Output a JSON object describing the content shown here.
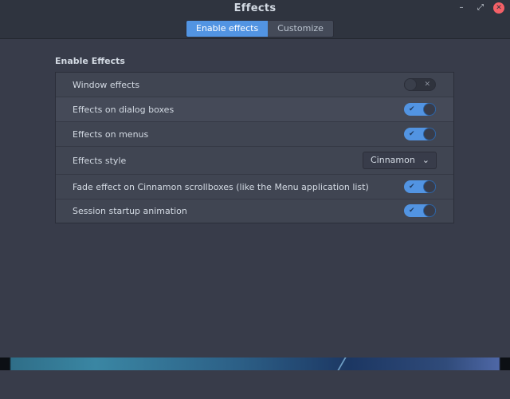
{
  "window": {
    "title": "Effects",
    "minimize_glyph": "–",
    "maximize_glyph": "⤢",
    "close_glyph": "✕"
  },
  "tabs": [
    {
      "label": "Enable effects",
      "active": true
    },
    {
      "label": "Customize",
      "active": false
    }
  ],
  "section": {
    "title": "Enable Effects"
  },
  "settings": [
    {
      "label": "Window effects",
      "control": "switch",
      "state": "off"
    },
    {
      "label": "Effects on dialog boxes",
      "control": "switch",
      "state": "on"
    },
    {
      "label": "Effects on menus",
      "control": "switch",
      "state": "on"
    },
    {
      "label": "Effects style",
      "control": "dropdown",
      "value": "Cinnamon"
    },
    {
      "label": "Fade effect on Cinnamon scrollboxes (like the Menu application list)",
      "control": "switch",
      "state": "on"
    },
    {
      "label": "Session startup animation",
      "control": "switch",
      "state": "on"
    }
  ],
  "switch_marks": {
    "on": "✔",
    "off": "✕"
  },
  "dropdown_arrow": "⌄",
  "colors": {
    "accent": "#5294e2",
    "background": "#383c4a",
    "titlebar": "#2f343f",
    "close": "#f46067"
  },
  "icons": {
    "minimize": "minimize-icon",
    "maximize": "maximize-icon",
    "close": "close-icon",
    "check": "check-icon",
    "cross": "cross-icon",
    "chevron": "chevron-down-icon"
  }
}
